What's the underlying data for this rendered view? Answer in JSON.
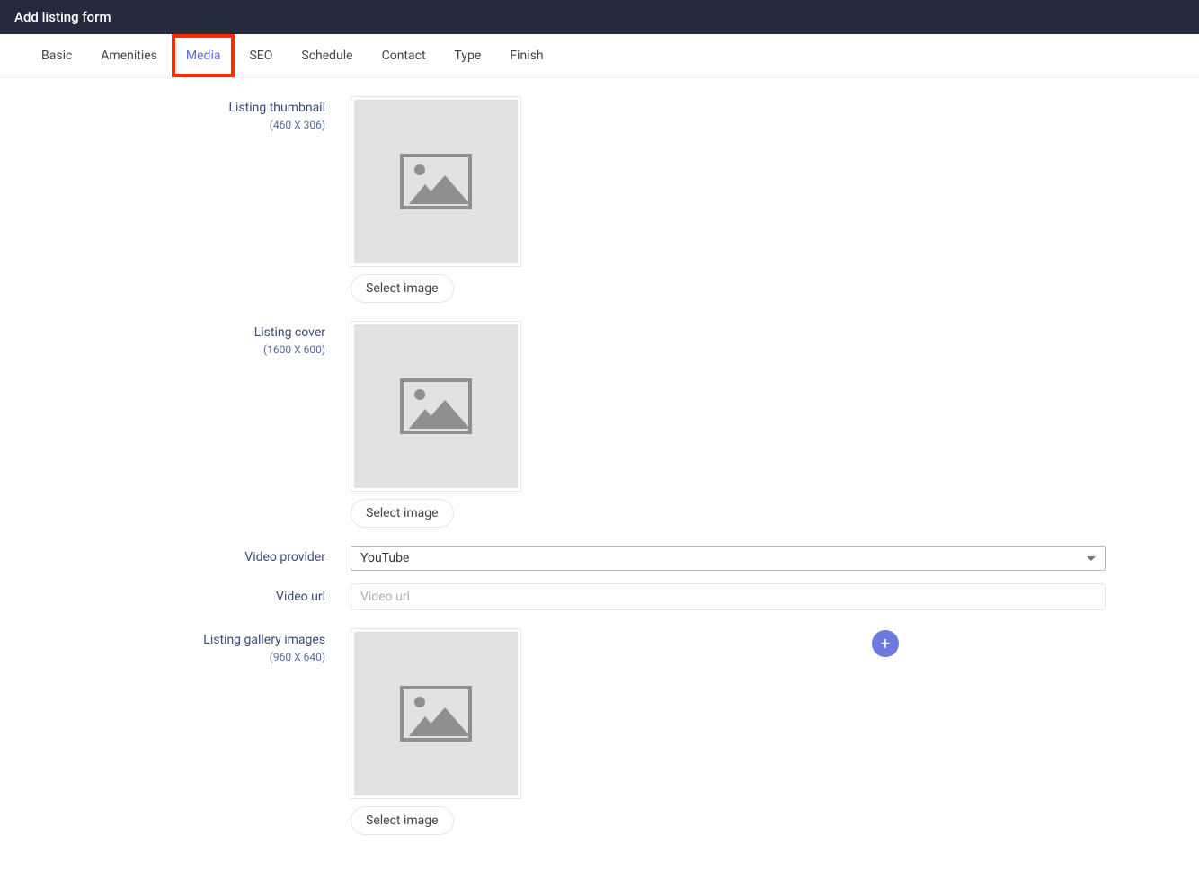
{
  "header": {
    "title": "Add listing form"
  },
  "tabs": [
    {
      "label": "Basic",
      "active": false,
      "highlighted": false
    },
    {
      "label": "Amenities",
      "active": false,
      "highlighted": false
    },
    {
      "label": "Media",
      "active": true,
      "highlighted": true
    },
    {
      "label": "SEO",
      "active": false,
      "highlighted": false
    },
    {
      "label": "Schedule",
      "active": false,
      "highlighted": false
    },
    {
      "label": "Contact",
      "active": false,
      "highlighted": false
    },
    {
      "label": "Type",
      "active": false,
      "highlighted": false
    },
    {
      "label": "Finish",
      "active": false,
      "highlighted": false
    }
  ],
  "fields": {
    "listing_thumbnail": {
      "label": "Listing thumbnail",
      "size_hint": "(460 X 306)",
      "select_button": "Select image"
    },
    "listing_cover": {
      "label": "Listing cover",
      "size_hint": "(1600 X 600)",
      "select_button": "Select image"
    },
    "video_provider": {
      "label": "Video provider",
      "value": "YouTube"
    },
    "video_url": {
      "label": "Video url",
      "placeholder": "Video url",
      "value": ""
    },
    "gallery": {
      "label": "Listing gallery images",
      "size_hint": "(960 X 640)",
      "select_button": "Select image"
    }
  }
}
